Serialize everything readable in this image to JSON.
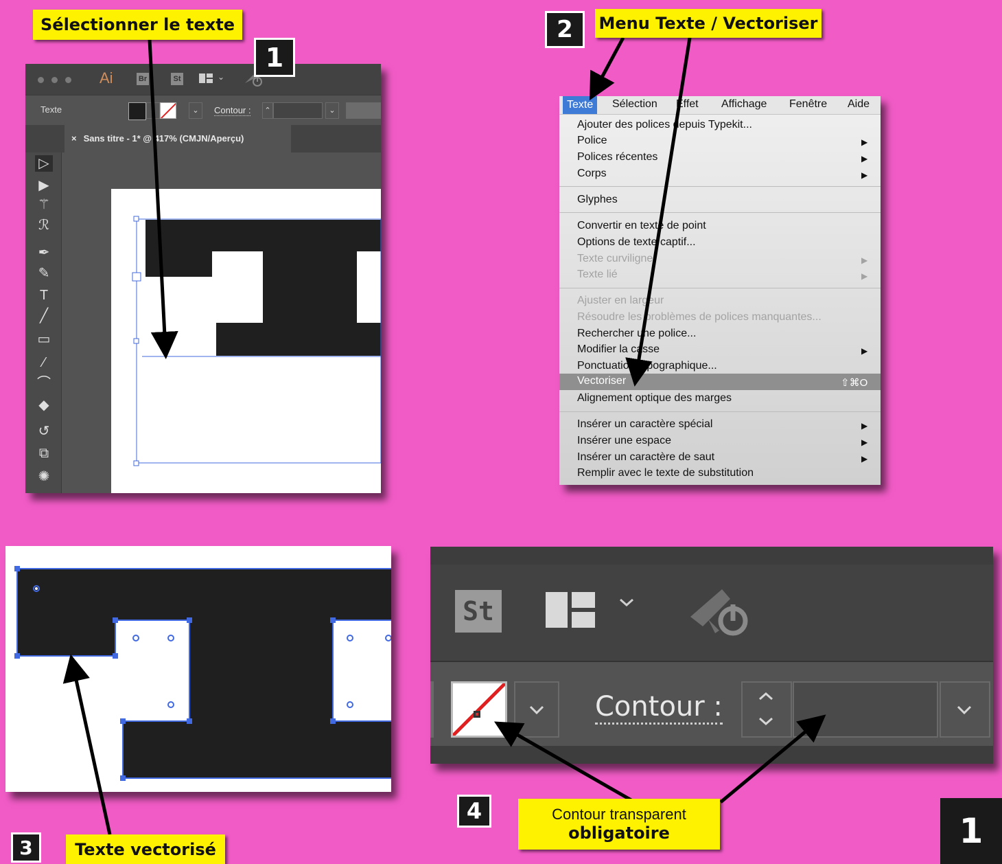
{
  "colors": {
    "background": "#f15bc6",
    "callout": "#fff200",
    "accent_blue": "#4169e1",
    "stroke_red": "#e02020"
  },
  "callouts": {
    "step1": "Sélectionner le texte",
    "step2": "Menu Texte / Vectoriser",
    "step3": "Texte vectorisé",
    "step4_line1": "Contour transparent",
    "step4_line2": "obligatoire"
  },
  "step_numbers": {
    "n1": "1",
    "n2": "2",
    "n3": "3",
    "n4": "4",
    "page": "1"
  },
  "illustrator": {
    "app_icon": "Ai",
    "bridge_icon": "Br",
    "stock_icon": "St",
    "control_label": "Texte",
    "stroke_label": "Contour :",
    "document_tab": "Sans titre - 1* @ 417% (CMJN/Aperçu)",
    "tab_close": "×",
    "tools": [
      "selection-tool-icon",
      "direct-selection-tool-icon",
      "magic-wand-icon",
      "lasso-icon",
      "pen-icon",
      "curvature-icon",
      "type-tool-icon",
      "line-tool-icon",
      "rectangle-tool-icon",
      "paintbrush-icon",
      "shaper-icon",
      "eraser-icon",
      "rotate-icon",
      "scale-icon",
      "puppet-warp-icon"
    ]
  },
  "menu": {
    "menubar": [
      "Texte",
      "Sélection",
      "Effet",
      "Affichage",
      "Fenêtre",
      "Aide"
    ],
    "items": [
      {
        "label": "Ajouter des polices depuis Typekit...",
        "disabled": false,
        "submenu": false
      },
      {
        "label": "Police",
        "disabled": false,
        "submenu": true
      },
      {
        "label": "Polices récentes",
        "disabled": false,
        "submenu": true
      },
      {
        "label": "Corps",
        "disabled": false,
        "submenu": true
      },
      {
        "label": "Glyphes",
        "disabled": false,
        "submenu": false
      },
      {
        "label": "Convertir en texte de point",
        "disabled": false,
        "submenu": false
      },
      {
        "label": "Options de texte captif...",
        "disabled": false,
        "submenu": false
      },
      {
        "label": "Texte curviligne",
        "disabled": true,
        "submenu": true
      },
      {
        "label": "Texte lié",
        "disabled": true,
        "submenu": true
      },
      {
        "label": "Ajuster en largeur",
        "disabled": true,
        "submenu": false
      },
      {
        "label": "Résoudre les problèmes de polices manquantes...",
        "disabled": true,
        "submenu": false
      },
      {
        "label": "Rechercher une police...",
        "disabled": false,
        "submenu": false
      },
      {
        "label": "Modifier la casse",
        "disabled": false,
        "submenu": true
      },
      {
        "label": "Ponctuation typographique...",
        "disabled": false,
        "submenu": false
      },
      {
        "label": "Vectoriser",
        "disabled": false,
        "submenu": false,
        "highlighted": true,
        "shortcut": "⇧⌘O"
      },
      {
        "label": "Alignement optique des marges",
        "disabled": false,
        "submenu": false
      },
      {
        "label": "Insérer un caractère spécial",
        "disabled": false,
        "submenu": true
      },
      {
        "label": "Insérer une espace",
        "disabled": false,
        "submenu": true
      },
      {
        "label": "Insérer un caractère de saut",
        "disabled": false,
        "submenu": true
      },
      {
        "label": "Remplir avec le texte de substitution",
        "disabled": false,
        "submenu": false
      }
    ]
  },
  "zoom_panel": {
    "stock_icon": "St",
    "stroke_label": "Contour :"
  }
}
